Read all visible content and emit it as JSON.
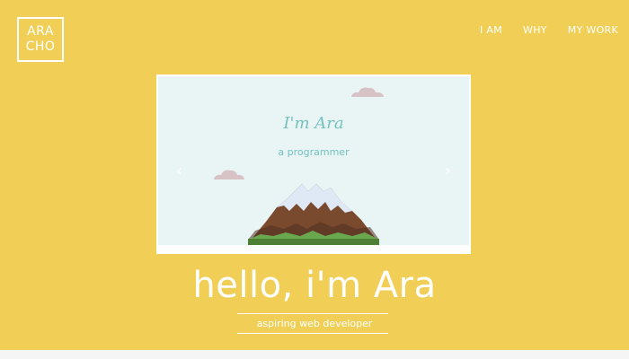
{
  "logo": {
    "line1": "ARA",
    "line2": "CHO"
  },
  "nav": {
    "items": [
      {
        "label": "I AM"
      },
      {
        "label": "WHY"
      },
      {
        "label": "MY WORK"
      }
    ]
  },
  "slider": {
    "title": "I'm Ara",
    "subtitle": "a programmer",
    "prev_icon": "chevron-left-icon",
    "next_icon": "chevron-right-icon"
  },
  "hero": {
    "title": "hello, i'm Ara",
    "subtitle": "aspiring web developer"
  },
  "colors": {
    "background": "#f1cf56",
    "text": "#ffffff",
    "slide_background": "#e9f4f5",
    "slide_text": "#74c1bd",
    "cloud": "#d7c3c6"
  }
}
